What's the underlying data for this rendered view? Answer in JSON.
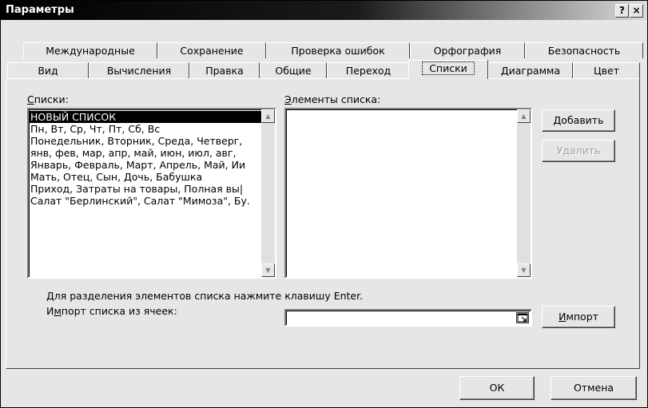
{
  "window": {
    "title": "Параметры",
    "help_label": "?",
    "close_label": "×"
  },
  "tabs_row1": [
    {
      "label": "Международные"
    },
    {
      "label": "Сохранение"
    },
    {
      "label": "Проверка ошибок"
    },
    {
      "label": "Орфография"
    },
    {
      "label": "Безопасность"
    }
  ],
  "tabs_row2": [
    {
      "label": "Вид"
    },
    {
      "label": "Вычисления"
    },
    {
      "label": "Правка"
    },
    {
      "label": "Общие"
    },
    {
      "label": "Переход"
    },
    {
      "label": "Списки"
    },
    {
      "label": "Диаграмма"
    },
    {
      "label": "Цвет"
    }
  ],
  "active_tab": "Списки",
  "lists": {
    "label_accel": "С",
    "label_rest": "писки:",
    "items": [
      "НОВЫЙ СПИСОК",
      "Пн, Вт, Ср, Чт, Пт, Сб, Вс",
      "Понедельник, Вторник, Среда, Четверг,",
      "янв, фев, мар, апр, май, июн, июл, авг,",
      "Январь, Февраль, Март, Апрель, Май, Ии",
      "Мать, Отец, Сын, Дочь, Бабушка",
      "Приход, Затраты на товары, Полная вы|",
      "Салат \"Берлинский\", Салат \"Мимоза\", Бу."
    ],
    "selected_index": 0
  },
  "entries": {
    "label_accel": "Э",
    "label_rest": "лементы списка:"
  },
  "buttons": {
    "add_accel": "Д",
    "add_rest": "обавить",
    "delete_label": "Удалить",
    "import_accel": "И",
    "import_rest": "мпорт",
    "ok_label": "ОК",
    "cancel_label": "Отмена"
  },
  "hint_text": "Для разделения элементов списка нажмите клавишу Enter.",
  "import_range": {
    "label_pre": "И",
    "label_accel": "м",
    "label_rest": "порт списка из ячеек:",
    "value": ""
  },
  "colors": {
    "face": "#e6e6e6",
    "selection": "#000000",
    "title_start": "#000000",
    "title_end": "#dcdcdc"
  }
}
